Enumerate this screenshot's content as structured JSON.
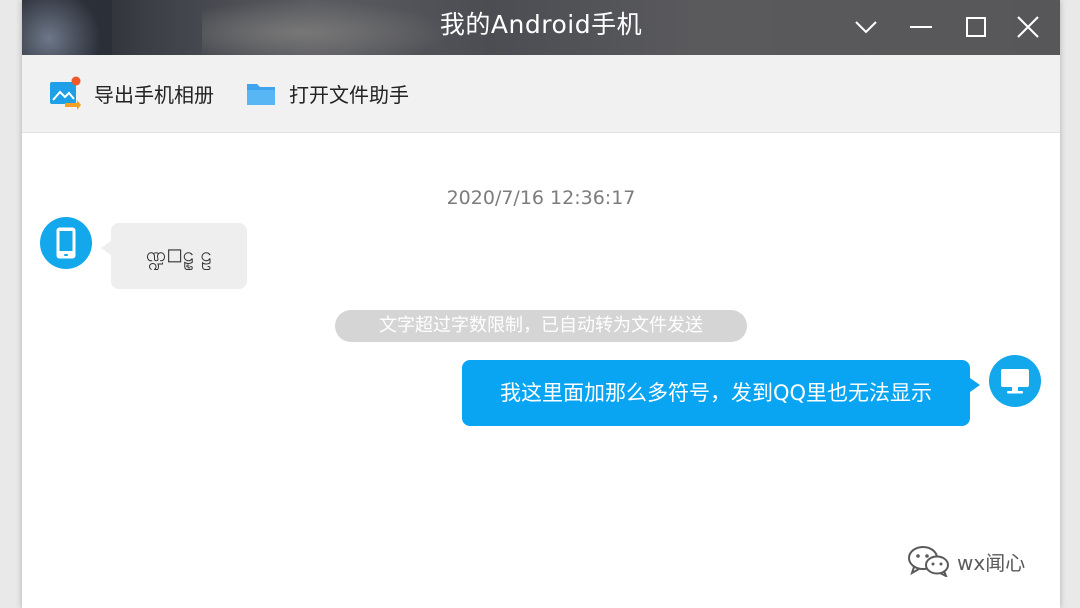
{
  "window": {
    "title": "我的Android手机"
  },
  "titlebar": {
    "icons": [
      "chevron-down-icon",
      "minimize-icon",
      "maximize-icon",
      "close-icon"
    ]
  },
  "toolbar": {
    "export_label": "导出手机相册",
    "export_icon": "photo-export-icon",
    "open_label": "打开文件助手",
    "open_icon": "folder-icon"
  },
  "chat": {
    "timestamp": "2020/7/16 12:36:17",
    "incoming_message": "ဏ္ဍ◻ဠဠ ဠ",
    "system_notice": "文字超过字数限制，已自动转为文件发送",
    "outgoing_message": "我这里面加那么多符号，发到QQ里也无法显示"
  },
  "watermark": {
    "text": "wx闻心",
    "icon": "wechat-icon"
  },
  "colors": {
    "accent": "#13a8ec",
    "outgoing_bubble": "#0aa5f2",
    "incoming_bubble": "#eeeeee",
    "notice_bg": "#d5d5d5",
    "toolbar_bg": "#f1f1f1",
    "export_dot": "#f0572b"
  }
}
